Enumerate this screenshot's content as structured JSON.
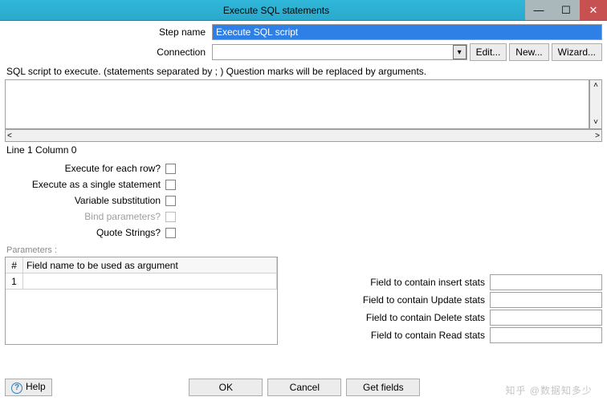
{
  "window": {
    "title": "Execute SQL statements"
  },
  "labels": {
    "step_name": "Step name",
    "connection": "Connection",
    "script_note": "SQL script to execute. (statements separated by ; ) Question marks will be replaced by arguments.",
    "line_status": "Line 1 Column 0",
    "exec_each_row": "Execute for each row?",
    "exec_single": "Execute as a single statement",
    "var_sub": "Variable substitution",
    "bind_params": "Bind parameters?",
    "quote_strings": "Quote Strings?",
    "params_header": "Parameters :",
    "col_hash": "#",
    "col_field": "Field name to be used as argument",
    "row1_idx": "1",
    "insert_stats": "Field to contain insert stats",
    "update_stats": "Field to contain Update stats",
    "delete_stats": "Field to contain Delete stats",
    "read_stats": "Field to contain Read stats"
  },
  "values": {
    "step_name": "Execute SQL script",
    "connection": "",
    "script": "",
    "insert": "",
    "update": "",
    "delete": "",
    "read": ""
  },
  "buttons": {
    "edit": "Edit...",
    "new": "New...",
    "wizard": "Wizard...",
    "help": "Help",
    "ok": "OK",
    "cancel": "Cancel",
    "get_fields": "Get fields"
  },
  "watermark": "知乎 @数据知多少"
}
